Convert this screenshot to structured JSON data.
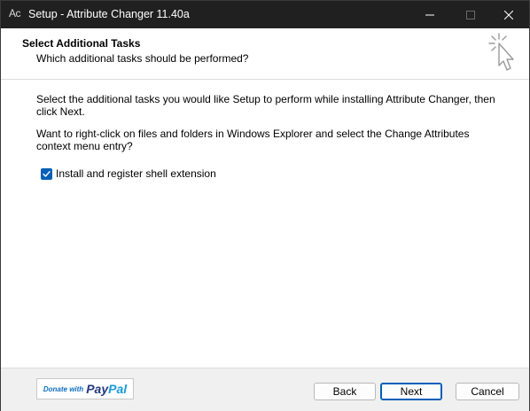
{
  "window": {
    "app_icon_text": "Ac",
    "title": "Setup - Attribute Changer 11.40a"
  },
  "header": {
    "title": "Select Additional Tasks",
    "subtitle": "Which additional tasks should be performed?",
    "icon": "cursor-click-icon"
  },
  "body": {
    "intro": "Select the additional tasks you would like Setup to perform while installing Attribute Changer, then click Next.",
    "question": "Want to right-click on files and folders in Windows Explorer and select the Change Attributes context menu entry?",
    "tasks": [
      {
        "label": "Install and register shell extension",
        "checked": true
      }
    ]
  },
  "footer": {
    "paypal": {
      "donate": "Donate with",
      "pay": "Pay",
      "pal": "Pal"
    },
    "back_label": "Back",
    "next_label": "Next",
    "cancel_label": "Cancel"
  },
  "colors": {
    "titlebar": "#202020",
    "accent": "#005fb8",
    "footer_bg": "#f0f0f0"
  }
}
